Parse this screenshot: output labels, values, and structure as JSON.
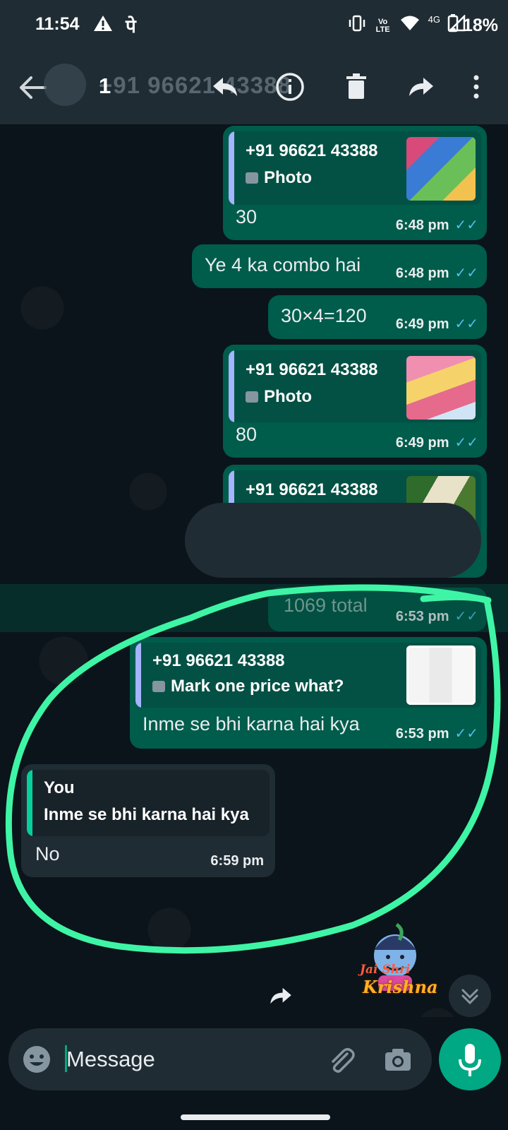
{
  "status_bar": {
    "time": "11:54",
    "carrier_glyph": "पे",
    "network": "4G",
    "volte": "Vo LTE",
    "battery": "18%"
  },
  "header": {
    "contact_title": "+91 96621 43388",
    "selected_count": "1"
  },
  "messages": [
    {
      "direction": "out",
      "quote": {
        "name": "+91 96621 43388",
        "text": "Photo"
      },
      "text": "30",
      "time": "6:48 pm",
      "ticks": "✓✓"
    },
    {
      "direction": "out",
      "text": "Ye 4 ka combo hai",
      "time": "6:48 pm",
      "ticks": "✓✓"
    },
    {
      "direction": "out",
      "text": "30×4=120",
      "time": "6:49 pm",
      "ticks": "✓✓"
    },
    {
      "direction": "out",
      "quote": {
        "name": "+91 96621 43388",
        "text": "Photo"
      },
      "text": "80",
      "time": "6:49 pm",
      "ticks": "✓✓"
    },
    {
      "direction": "out",
      "quote": {
        "name": "+91 96621 43388",
        "text": ""
      }
    },
    {
      "direction": "out",
      "text": "1069 total",
      "time": "6:53 pm",
      "ticks": "✓✓"
    },
    {
      "direction": "out",
      "quote": {
        "name": "+91 96621 43388",
        "text": "Mark one price what?"
      },
      "text": "Inme se bhi karna hai kya",
      "time": "6:53 pm",
      "ticks": "✓✓"
    },
    {
      "direction": "in",
      "quote": {
        "name": "You",
        "text": "Inme se bhi karna hai kya"
      },
      "text": "No",
      "time": "6:59 pm"
    }
  ],
  "sticker": {
    "line1": "Jai Shri",
    "line2": "Krishna"
  },
  "composer": {
    "placeholder": "Message"
  },
  "colors": {
    "outgoing_bubble": "#005c4b",
    "incoming_bubble": "#1f2c34",
    "accent": "#00a884",
    "read_ticks": "#53bdeb",
    "annotation_circle": "#3ef5a5"
  },
  "icons": {
    "status": [
      "warning-icon",
      "vibrate-icon",
      "wifi-icon",
      "signal-icon",
      "battery-icon"
    ],
    "header": [
      "back-arrow-icon",
      "reply-icon",
      "info-icon",
      "delete-icon",
      "forward-icon",
      "more-vert-icon"
    ],
    "composer": [
      "emoji-icon",
      "attach-icon",
      "camera-icon",
      "mic-icon"
    ]
  }
}
